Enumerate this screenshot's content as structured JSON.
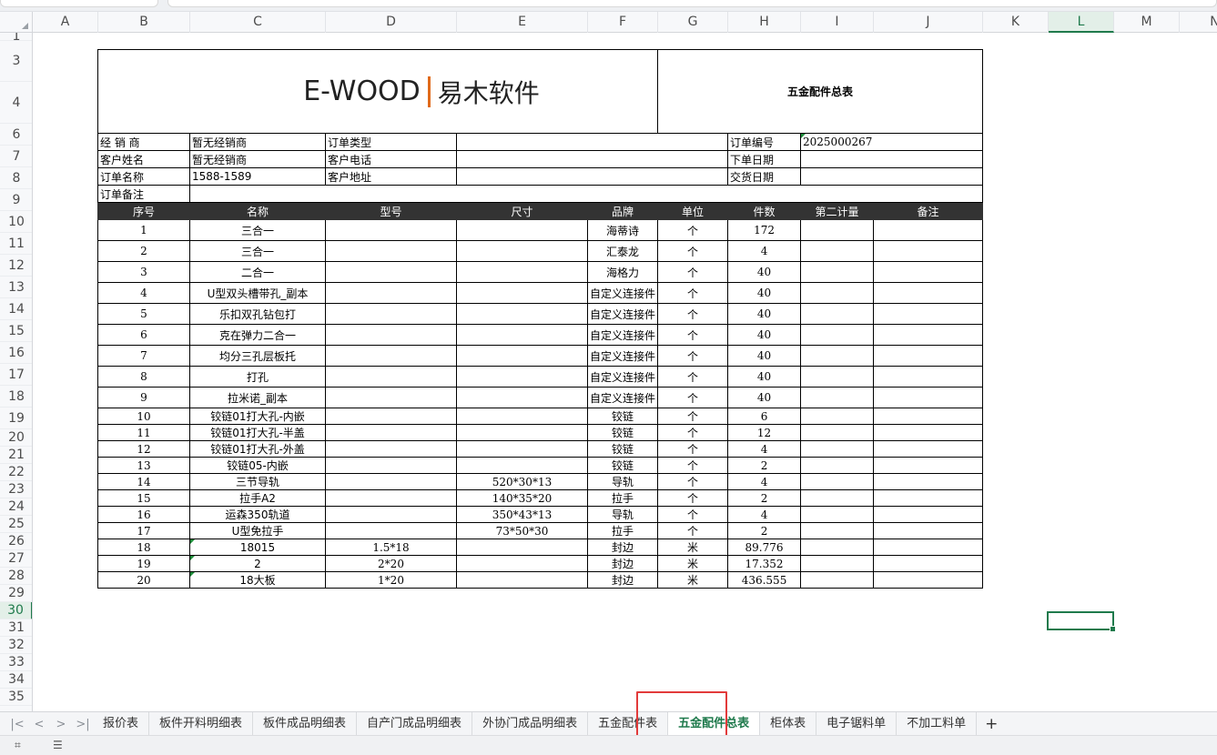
{
  "columns": [
    "A",
    "B",
    "C",
    "D",
    "E",
    "F",
    "G",
    "H",
    "I",
    "J",
    "K",
    "L",
    "M",
    "N"
  ],
  "selected_column": "L",
  "rows": [
    "1",
    "3",
    "4",
    "6",
    "7",
    "8",
    "9",
    "10",
    "11",
    "12",
    "13",
    "14",
    "15",
    "16",
    "17",
    "18",
    "19",
    "20",
    "21",
    "22",
    "23",
    "24",
    "25",
    "26",
    "27",
    "28",
    "29",
    "30",
    "31",
    "32",
    "33",
    "34",
    "35"
  ],
  "selected_row": "30",
  "form": {
    "logo_en": "E-WOOD",
    "logo_zh": "易木软件",
    "title": "五金配件总表",
    "info": [
      {
        "l1": "经 销 商",
        "v1": "暂无经销商",
        "l2": "订单类型",
        "v2": "",
        "l3": "订单编号",
        "v3": "2025000267"
      },
      {
        "l1": "客户姓名",
        "v1": "暂无经销商",
        "l2": "客户电话",
        "v2": "",
        "l3": "下单日期",
        "v3": ""
      },
      {
        "l1": "订单名称",
        "v1": "1588-1589",
        "l2": "客户地址",
        "v2": "",
        "l3": "交货日期",
        "v3": ""
      }
    ],
    "remark_label": "订单备注",
    "remark_value": "",
    "headers": [
      "序号",
      "名称",
      "型号",
      "尺寸",
      "品牌",
      "单位",
      "件数",
      "第二计量",
      "备注"
    ],
    "items": [
      [
        "1",
        "三合一",
        "",
        "",
        "海蒂诗",
        "个",
        "172",
        "",
        ""
      ],
      [
        "2",
        "三合一",
        "",
        "",
        "汇泰龙",
        "个",
        "4",
        "",
        ""
      ],
      [
        "3",
        "二合一",
        "",
        "",
        "海格力",
        "个",
        "40",
        "",
        ""
      ],
      [
        "4",
        "U型双头槽带孔_副本",
        "",
        "",
        "自定义连接件",
        "个",
        "40",
        "",
        ""
      ],
      [
        "5",
        "乐扣双孔钻包打",
        "",
        "",
        "自定义连接件",
        "个",
        "40",
        "",
        ""
      ],
      [
        "6",
        "克在弹力二合一",
        "",
        "",
        "自定义连接件",
        "个",
        "40",
        "",
        ""
      ],
      [
        "7",
        "均分三孔层板托",
        "",
        "",
        "自定义连接件",
        "个",
        "40",
        "",
        ""
      ],
      [
        "8",
        "打孔",
        "",
        "",
        "自定义连接件",
        "个",
        "40",
        "",
        ""
      ],
      [
        "9",
        "拉米诺_副本",
        "",
        "",
        "自定义连接件",
        "个",
        "40",
        "",
        ""
      ],
      [
        "10",
        "铰链01打大孔-内嵌",
        "",
        "",
        "铰链",
        "个",
        "6",
        "",
        ""
      ],
      [
        "11",
        "铰链01打大孔-半盖",
        "",
        "",
        "铰链",
        "个",
        "12",
        "",
        ""
      ],
      [
        "12",
        "铰链01打大孔-外盖",
        "",
        "",
        "铰链",
        "个",
        "4",
        "",
        ""
      ],
      [
        "13",
        "铰链05-内嵌",
        "",
        "",
        "铰链",
        "个",
        "2",
        "",
        ""
      ],
      [
        "14",
        "三节导轨",
        "",
        "520*30*13",
        "导轨",
        "个",
        "4",
        "",
        ""
      ],
      [
        "15",
        "拉手A2",
        "",
        "140*35*20",
        "拉手",
        "个",
        "2",
        "",
        ""
      ],
      [
        "16",
        "运森350轨道",
        "",
        "350*43*13",
        "导轨",
        "个",
        "4",
        "",
        ""
      ],
      [
        "17",
        "U型免拉手",
        "",
        "73*50*30",
        "拉手",
        "个",
        "2",
        "",
        ""
      ],
      [
        "18",
        "18015",
        "1.5*18",
        "",
        "封边",
        "米",
        "89.776",
        "",
        ""
      ],
      [
        "19",
        "2",
        "2*20",
        "",
        "封边",
        "米",
        "17.352",
        "",
        ""
      ],
      [
        "20",
        "18大板",
        "1*20",
        "",
        "封边",
        "米",
        "436.555",
        "",
        ""
      ]
    ]
  },
  "sheet_nav": [
    "|<",
    "<",
    ">",
    ">|"
  ],
  "sheet_tabs": [
    "报价表",
    "板件开料明细表",
    "板件成品明细表",
    "自产门成品明细表",
    "外协门成品明细表",
    "五金配件表",
    "五金配件总表",
    "柜体表",
    "电子锯料单",
    "不加工料单"
  ],
  "active_tab": "五金配件总表",
  "add_sheet": "+",
  "status_icons": [
    "macro-icon",
    "sheet-list-icon"
  ]
}
